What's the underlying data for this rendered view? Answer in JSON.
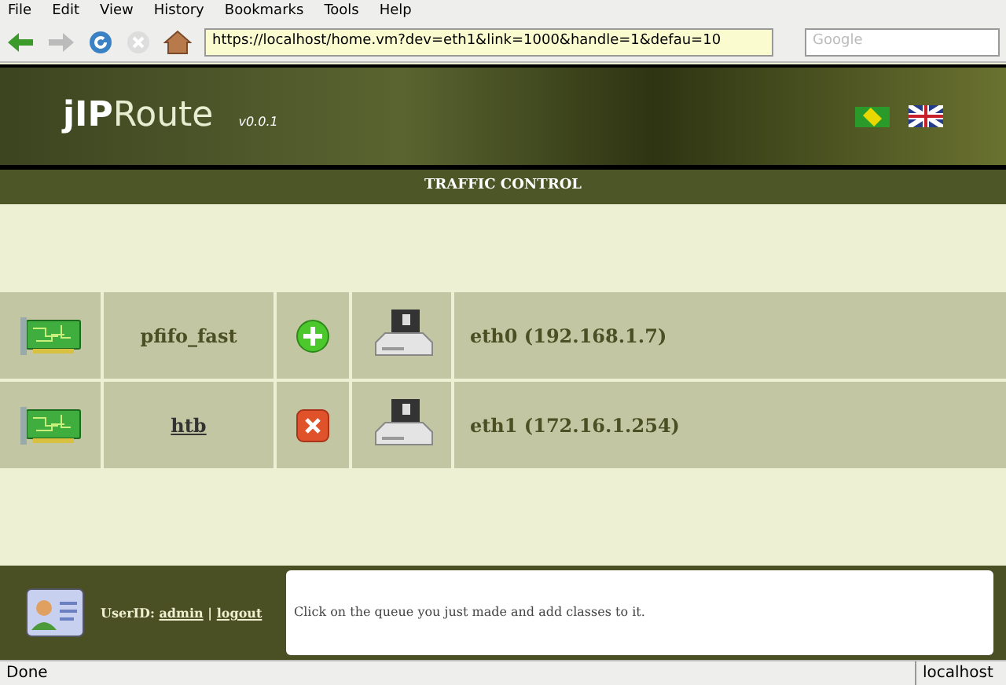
{
  "menu": [
    "File",
    "Edit",
    "View",
    "History",
    "Bookmarks",
    "Tools",
    "Help"
  ],
  "address": {
    "value": "https://localhost/home.vm?dev=eth1&link=1000&handle=1&defau=10"
  },
  "search": {
    "placeholder": "Google"
  },
  "header": {
    "logo_bold": "jIP",
    "logo_light": "Route",
    "version": "v0.0.1"
  },
  "title": "TRAFFIC CONTROL",
  "rows": [
    {
      "queue": "pfifo_fast",
      "link": false,
      "kind": "add",
      "interface": "eth0 (192.168.1.7)"
    },
    {
      "queue": "htb",
      "link": true,
      "kind": "remove",
      "interface": "eth1 (172.16.1.254)"
    }
  ],
  "footer": {
    "user_label": "UserID:",
    "user": "admin",
    "separator": "|",
    "logout": "logout",
    "message": "Click on the queue you just made and add classes to it."
  },
  "status_bar": {
    "text": "Done",
    "host": "localhost"
  }
}
